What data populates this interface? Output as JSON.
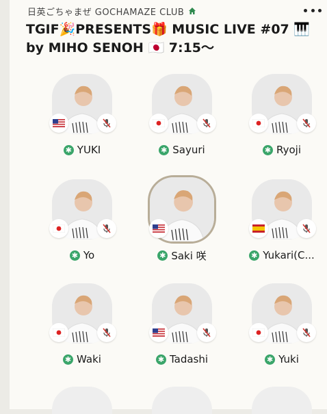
{
  "header": {
    "club_name": "日英ごちゃまぜ GOCHAMAZE CLUB",
    "title": "TGIF🎉PRESENTS🎁 MUSIC LIVE #07 🎹 by MIHO SENOH 🇯🇵 7:15〜"
  },
  "speakers": [
    {
      "name": "YUKI",
      "flag": "us",
      "muted": true,
      "speaking": false
    },
    {
      "name": "Sayuri",
      "flag": "jp",
      "muted": true,
      "speaking": false
    },
    {
      "name": "Ryoji",
      "flag": "jp",
      "muted": true,
      "speaking": false
    },
    {
      "name": "Yo",
      "flag": "jp",
      "muted": true,
      "speaking": false
    },
    {
      "name": "Saki 咲",
      "flag": "us",
      "muted": false,
      "speaking": true
    },
    {
      "name": "Yukari(C...",
      "flag": "es",
      "muted": true,
      "speaking": false
    },
    {
      "name": "Waki",
      "flag": "jp",
      "muted": true,
      "speaking": false
    },
    {
      "name": "Tadashi",
      "flag": "us",
      "muted": true,
      "speaking": false
    },
    {
      "name": "Yuki",
      "flag": "jp",
      "muted": true,
      "speaking": false
    }
  ],
  "colors": {
    "accent_green": "#3aa56a",
    "speaking_ring": "#b8ad98",
    "mute_red": "#d2322d"
  },
  "icons": {
    "more": "more-icon",
    "home": "home-icon",
    "moderator_badge": "star-icon",
    "muted": "mic-muted-icon"
  }
}
